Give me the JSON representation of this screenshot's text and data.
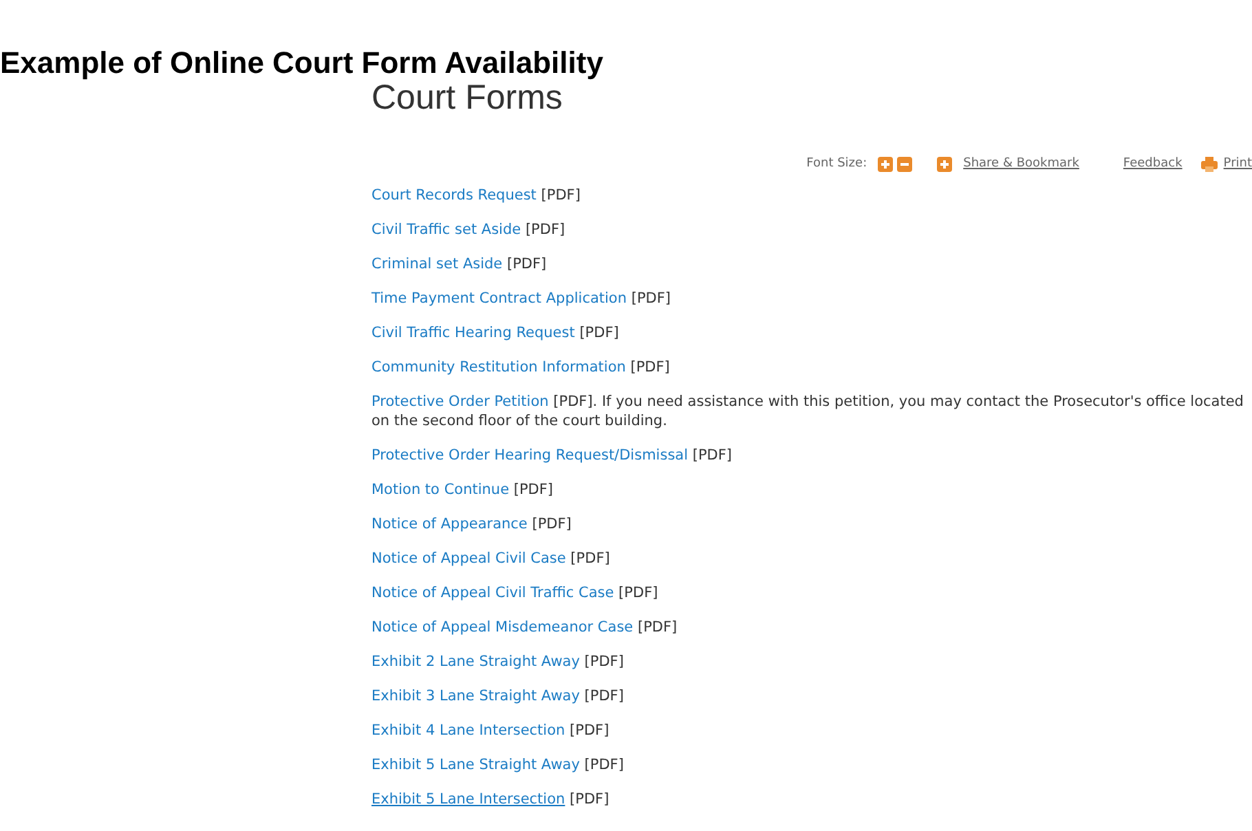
{
  "caption": "Example of Online Court Form Availability",
  "heading": "Court Forms",
  "toolbar": {
    "font_size_label": "Font Size:",
    "share": "Share & Bookmark",
    "feedback": "Feedback",
    "print": "Print"
  },
  "forms": [
    {
      "link": "Court Records Request",
      "text": "[PDF]",
      "hovered": false
    },
    {
      "link": "Civil Traffic set Aside",
      "text": "[PDF]",
      "hovered": false
    },
    {
      "link": "Criminal set Aside",
      "text": "[PDF]",
      "hovered": false
    },
    {
      "link": "Time Payment Contract Application",
      "text": "[PDF]",
      "hovered": false
    },
    {
      "link": "Civil Traffic Hearing Request",
      "text": "[PDF]",
      "hovered": false
    },
    {
      "link": "Community Restitution Information",
      "text": "[PDF]",
      "hovered": false
    },
    {
      "link": "Protective Order Petition",
      "text": "[PDF].  If you need assistance with this petition, you may contact the Prosecutor's office located on the second floor of the court building.",
      "hovered": false
    },
    {
      "link": "Protective Order Hearing Request/Dismissal",
      "text": "[PDF]",
      "hovered": false
    },
    {
      "link": "Motion to Continue",
      "text": "[PDF]",
      "hovered": false
    },
    {
      "link": "Notice of Appearance",
      "text": "[PDF]",
      "hovered": false
    },
    {
      "link": "Notice of Appeal Civil Case",
      "text": "[PDF]",
      "hovered": false
    },
    {
      "link": "Notice of Appeal Civil Traffic Case",
      "text": "[PDF]",
      "hovered": false
    },
    {
      "link": "Notice of Appeal Misdemeanor Case",
      "text": "[PDF]",
      "hovered": false
    },
    {
      "link": "Exhibit 2 Lane Straight Away",
      "text": "[PDF]",
      "hovered": false
    },
    {
      "link": "Exhibit 3 Lane Straight Away",
      "text": "[PDF]",
      "hovered": false
    },
    {
      "link": "Exhibit 4 Lane Intersection",
      "text": "[PDF]",
      "hovered": false
    },
    {
      "link": "Exhibit 5 Lane Straight Away",
      "text": "[PDF]",
      "hovered": false
    },
    {
      "link": "Exhibit 5 Lane Intersection",
      "text": "[PDF]",
      "hovered": true
    }
  ]
}
